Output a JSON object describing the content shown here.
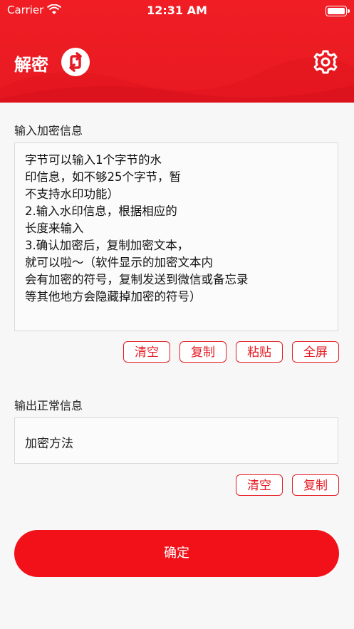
{
  "status_bar": {
    "carrier": "Carrier",
    "time": "12:31 AM"
  },
  "header": {
    "title": "解密",
    "switch_icon": "swap-arrows-icon",
    "settings_icon": "gear-icon"
  },
  "input_section": {
    "label": "输入加密信息",
    "lines": [
      "字节可以输入1个字节的水",
      "印信息，如不够25个字节，暂",
      "不支持水印功能）",
      "2.输入水印信息，根据相应的",
      "长度来输入",
      "3.确认加密后，复制加密文本，",
      "就可以啦～（软件显示的加密文本内",
      "会有加密的符号，复制发送到微信或备忘录",
      "等其他地方会隐藏掉加密的符号）"
    ],
    "buttons": {
      "clear": "清空",
      "copy": "复制",
      "paste": "粘贴",
      "fullscreen": "全屏"
    }
  },
  "output_section": {
    "label": "输出正常信息",
    "value": "加密方法",
    "buttons": {
      "clear": "清空",
      "copy": "复制"
    }
  },
  "confirm_button": "确定",
  "colors": {
    "brand": "#e51b23",
    "header_bg": "#f01d24"
  }
}
